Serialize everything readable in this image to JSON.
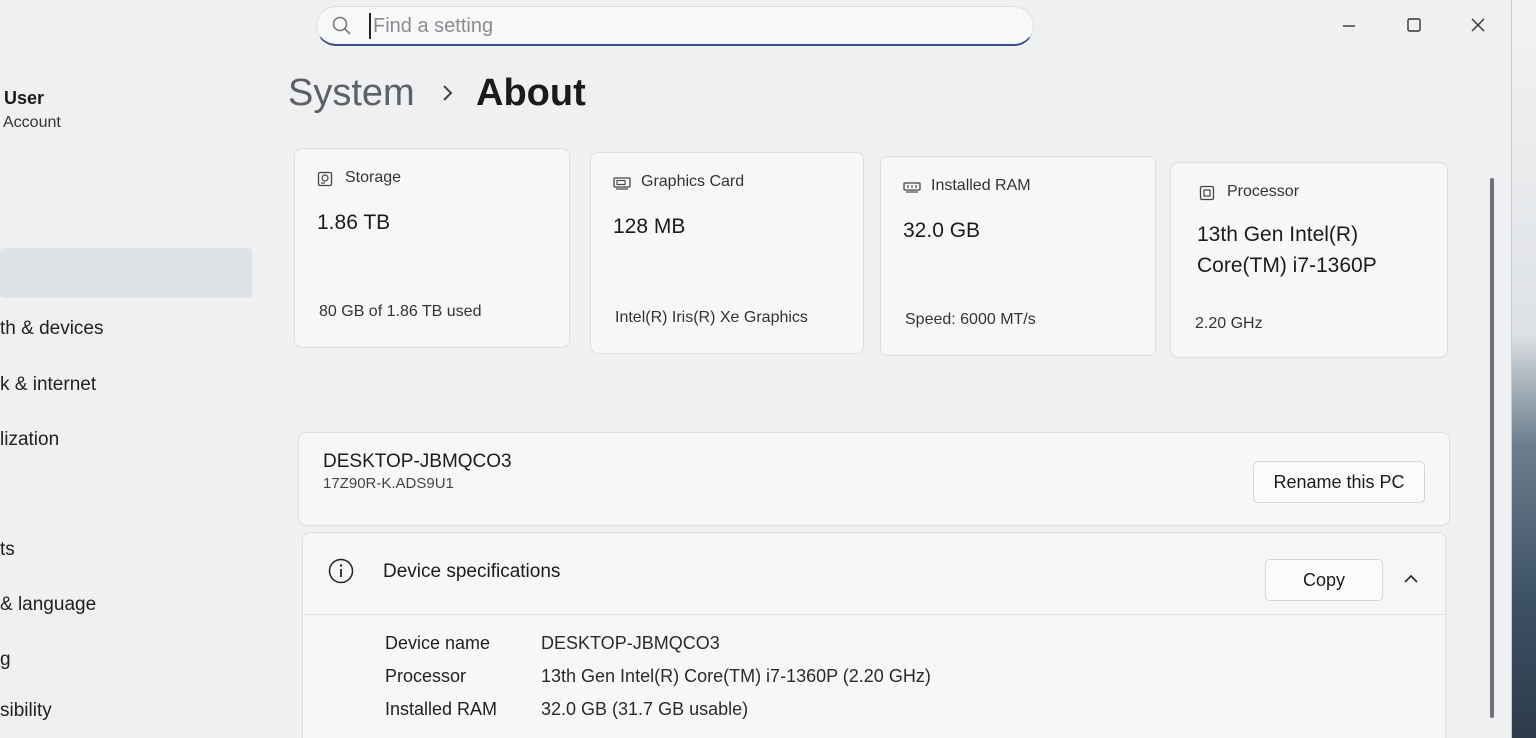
{
  "search": {
    "placeholder": "Find a setting"
  },
  "breadcrumb": {
    "parent": "System",
    "current": "About"
  },
  "sidebar": {
    "user_name": "User",
    "user_sub": "Account",
    "items": [
      {
        "label": "th & devices"
      },
      {
        "label": "k & internet"
      },
      {
        "label": "lization"
      },
      {
        "label": "ts"
      },
      {
        "label": "& language"
      },
      {
        "label": "g"
      },
      {
        "label": "sibility"
      }
    ]
  },
  "cards": [
    {
      "title": "Storage",
      "value": "1.86 TB",
      "detail": "80 GB of 1.86 TB used",
      "icon": "storage-icon"
    },
    {
      "title": "Graphics Card",
      "value": "128 MB",
      "detail": "Intel(R) Iris(R) Xe Graphics",
      "icon": "graphics-card-icon"
    },
    {
      "title": "Installed RAM",
      "value": "32.0 GB",
      "detail": "Speed: 6000 MT/s",
      "icon": "ram-icon"
    },
    {
      "title": "Processor",
      "value": "13th Gen Intel(R) Core(TM) i7-1360P",
      "detail": "2.20 GHz",
      "icon": "processor-icon"
    }
  ],
  "device": {
    "name": "DESKTOP-JBMQCO3",
    "model": "17Z90R-K.ADS9U1",
    "rename_label": "Rename this PC"
  },
  "specs": {
    "title": "Device specifications",
    "copy_label": "Copy",
    "rows": [
      {
        "label": "Device name",
        "value": "DESKTOP-JBMQCO3"
      },
      {
        "label": "Processor",
        "value": "13th Gen Intel(R) Core(TM) i7-1360P (2.20 GHz)"
      },
      {
        "label": "Installed RAM",
        "value": "32.0 GB (31.7 GB usable)"
      }
    ]
  }
}
